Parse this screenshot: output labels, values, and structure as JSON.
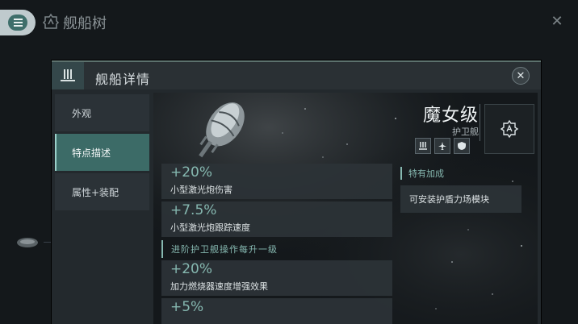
{
  "app": {
    "title": "舰船树",
    "close_glyph": "✕"
  },
  "dialog": {
    "title": "舰船详情",
    "close_glyph": "✕",
    "tabs": [
      {
        "label": "外观",
        "active": false
      },
      {
        "label": "特点描述",
        "active": true
      },
      {
        "label": "属性+装配",
        "active": false
      }
    ]
  },
  "ship": {
    "name": "魔女级",
    "class": "护卫舰",
    "role_icons": [
      "weapon-turret-icon",
      "aircraft-icon",
      "shield-icon"
    ],
    "badge_icon": "chip-a-icon"
  },
  "bonuses": {
    "base": [
      {
        "value": "+20%",
        "desc": "小型激光炮伤害"
      },
      {
        "value": "+7.5%",
        "desc": "小型激光炮跟踪速度"
      }
    ],
    "section_title": "进阶护卫舰操作每升一级",
    "per_level": [
      {
        "value": "+20%",
        "desc": "加力燃烧器速度增强效果"
      },
      {
        "value": "+5%",
        "desc": ""
      }
    ]
  },
  "special": {
    "title": "特有加成",
    "items": [
      "可安装护盾力场模块"
    ]
  },
  "colors": {
    "accent": "#86b8b0",
    "active_tab": "#3c6b67",
    "panel": "#23292d"
  }
}
